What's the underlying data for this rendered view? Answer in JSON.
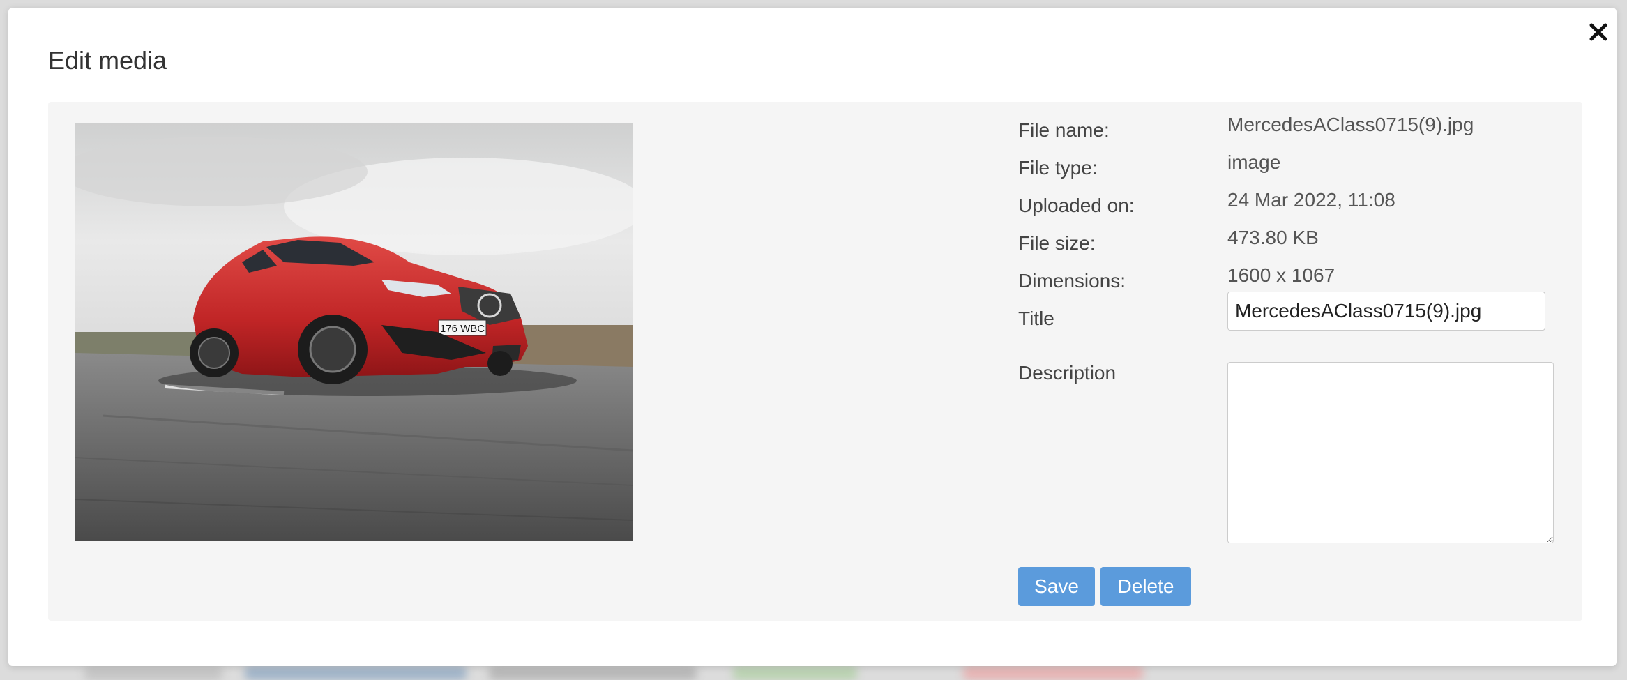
{
  "modal": {
    "title": "Edit media",
    "close_icon": "close-icon"
  },
  "preview": {
    "subject": "red Mercedes hatchback on road",
    "plate": "176 WBC"
  },
  "details": {
    "file_name_label": "File name:",
    "file_name_value": "MercedesAClass0715(9).jpg",
    "file_type_label": "File type:",
    "file_type_value": "image",
    "uploaded_label": "Uploaded on:",
    "uploaded_value": "24 Mar 2022, 11:08",
    "file_size_label": "File size:",
    "file_size_value": "473.80 KB",
    "dimensions_label": "Dimensions:",
    "dimensions_value": "1600 x 1067",
    "title_label": "Title",
    "title_value": "MercedesAClass0715(9).jpg",
    "description_label": "Description",
    "description_value": ""
  },
  "actions": {
    "save_label": "Save",
    "delete_label": "Delete"
  },
  "colors": {
    "button": "#5b9bdc",
    "panel": "#f5f5f5",
    "car_body": "#c8282a"
  }
}
